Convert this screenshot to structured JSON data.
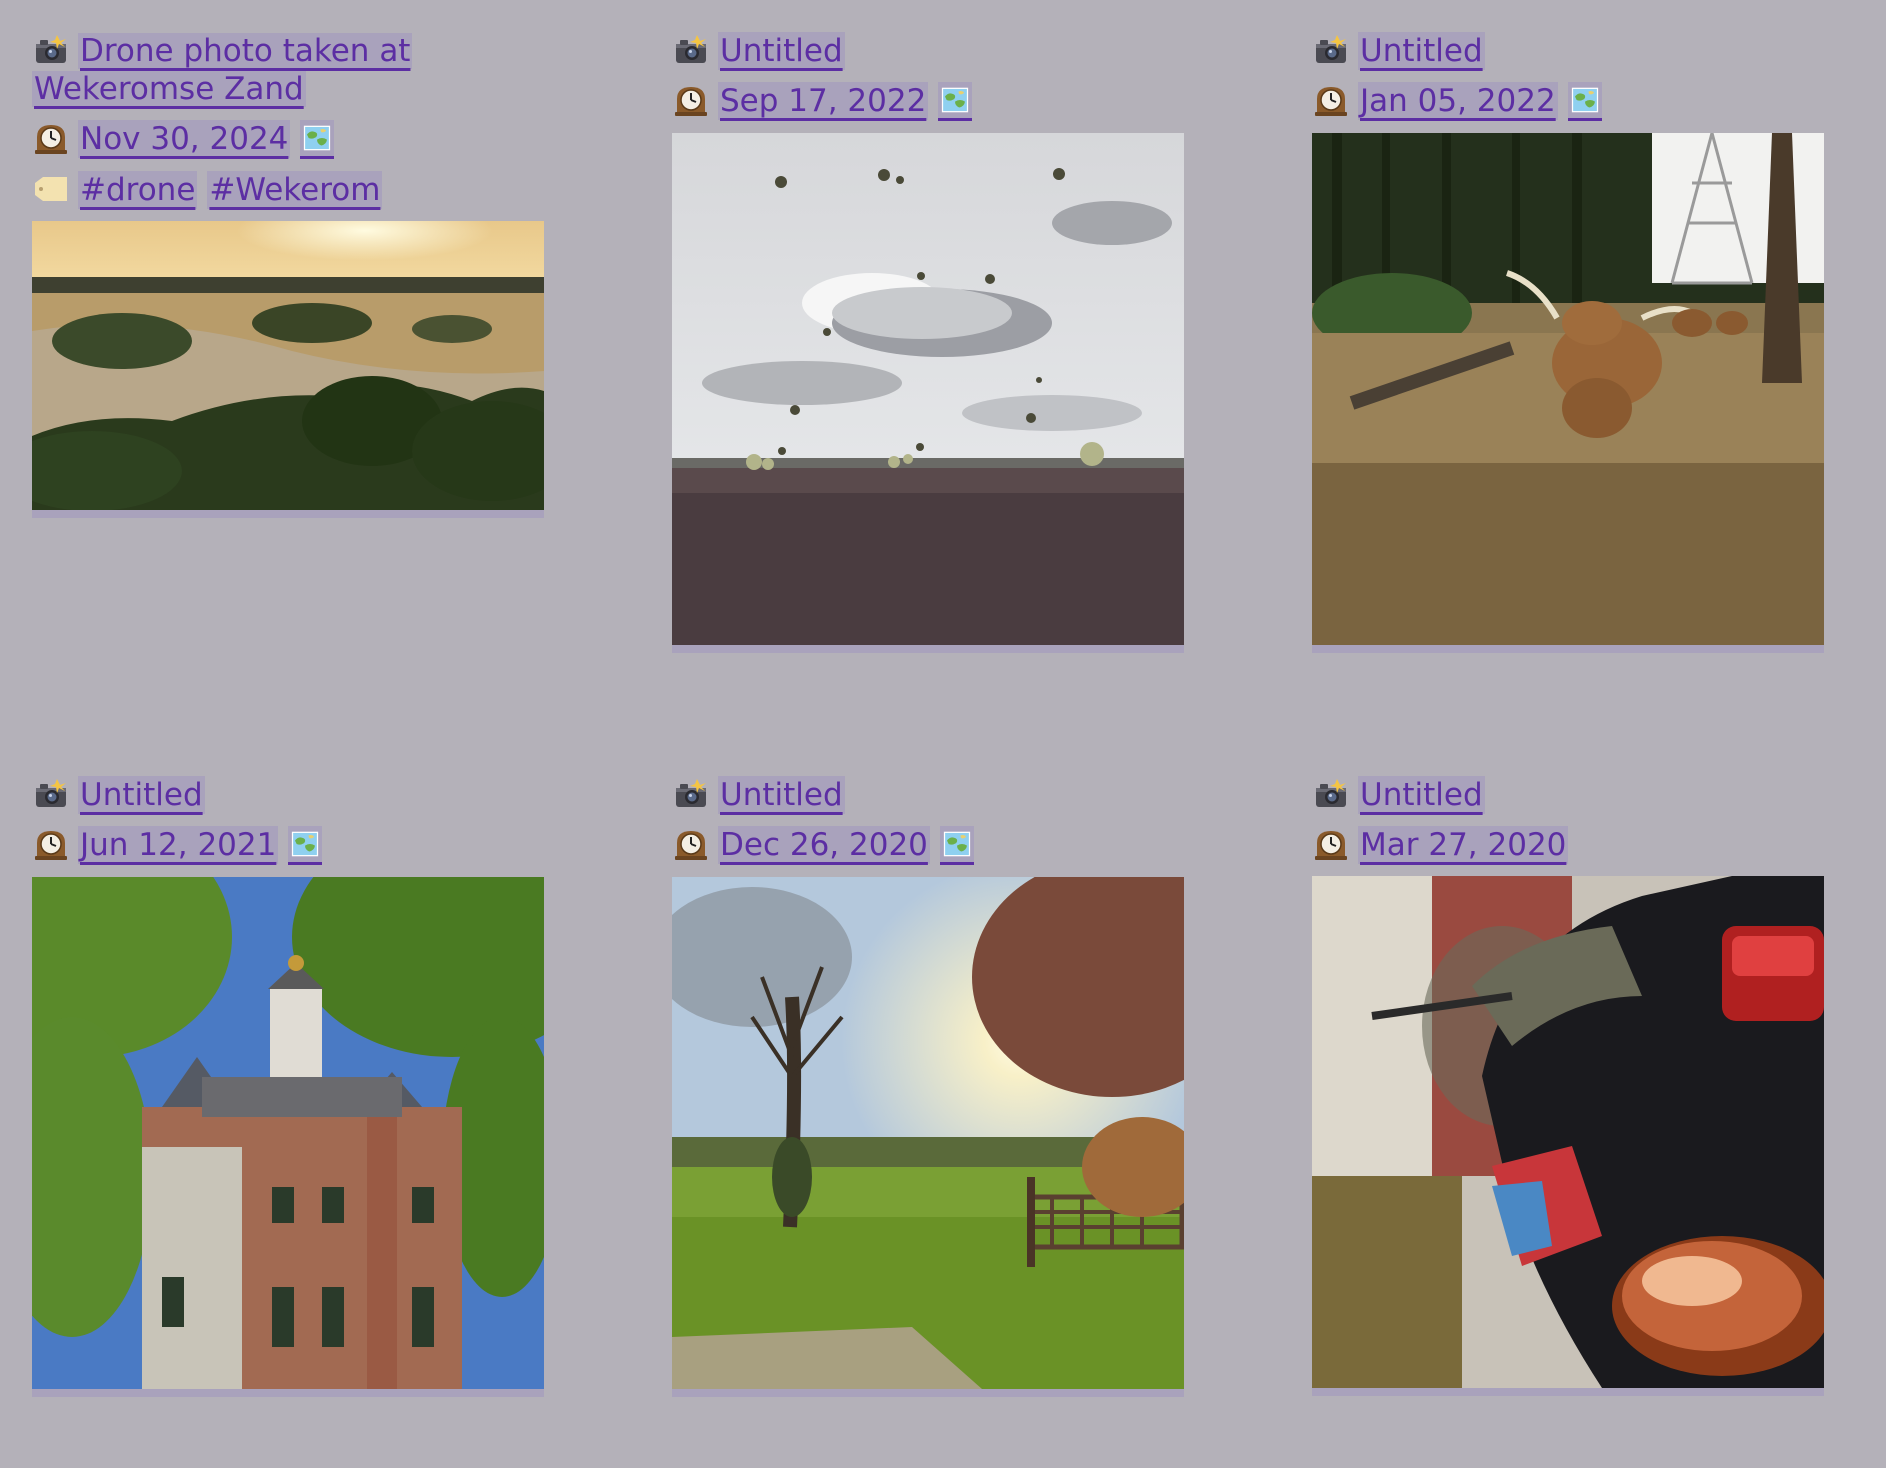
{
  "cards": [
    {
      "title_line1": "Drone photo taken at",
      "title_line2": "Wekeromse Zand",
      "date": "Nov 30, 2024",
      "tags": [
        "#drone",
        "#Wekerom"
      ],
      "image": "heathland sunset from drone"
    },
    {
      "title": "Untitled",
      "date": "Sep 17, 2022",
      "image": "parachutists over heath"
    },
    {
      "title": "Untitled",
      "date": "Jan 05, 2022",
      "image": "highland cow in forest"
    },
    {
      "title": "Untitled",
      "date": "Jun 12, 2021",
      "image": "castle through trees"
    },
    {
      "title": "Untitled",
      "date": "Dec 26, 2020",
      "image": "sunset field with gate"
    },
    {
      "title": "Untitled",
      "date": "Mar 27, 2020",
      "image": "motorcycle rear light"
    }
  ],
  "icons": {
    "camera": "camera-flash-icon",
    "clock": "mantelpiece-clock-icon",
    "tag": "label-tag-icon",
    "map": "world-map-icon"
  },
  "colors": {
    "background": "#b4b1b9",
    "link": "#5c2ea3",
    "chip": "#a9a2bc"
  }
}
